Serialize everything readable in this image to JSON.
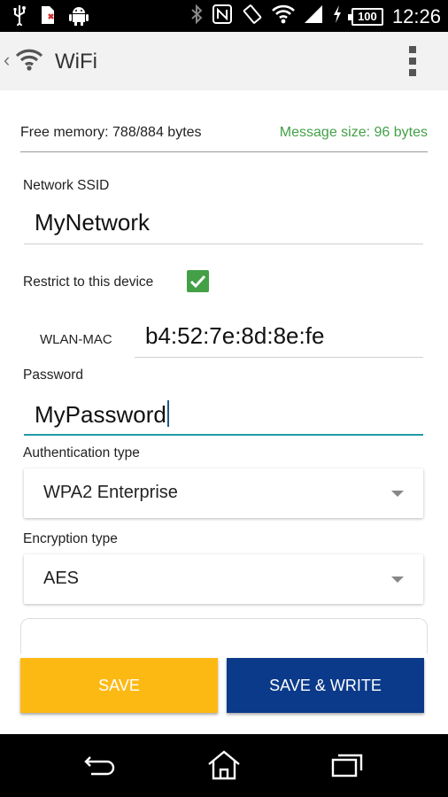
{
  "status_bar": {
    "battery": "100",
    "time": "12:26",
    "icons": [
      "usb-icon",
      "sim-error-icon",
      "android-icon",
      "bluetooth-icon",
      "nfc-icon",
      "rotate-icon",
      "wifi-signal-icon",
      "cell-signal-icon",
      "charging-icon",
      "battery-icon"
    ]
  },
  "action_bar": {
    "title": "WiFi",
    "icons": [
      "back-chevron-icon",
      "wifi-logo-icon",
      "overflow-menu-icon"
    ]
  },
  "memory": {
    "free": "Free memory: 788/884 bytes",
    "message_size": "Message size: 96 bytes",
    "message_color": "#43a047"
  },
  "form": {
    "ssid_label": "Network SSID",
    "ssid_value": "MyNetwork",
    "restrict_label": "Restrict to this device",
    "restrict_checked": true,
    "mac_label": "WLAN-MAC",
    "mac_value": "b4:52:7e:8d:8e:fe",
    "password_label": "Password",
    "password_value": "MyPassword",
    "auth_label": "Authentication type",
    "auth_value": "WPA2 Enterprise",
    "enc_label": "Encryption type",
    "enc_value": "AES"
  },
  "buttons": {
    "save": "SAVE",
    "save_write": "SAVE & WRITE",
    "save_color": "#fdb913",
    "save_write_color": "#0b3a8a"
  },
  "nav_bar": {
    "icons": [
      "back-icon",
      "home-icon",
      "recents-icon"
    ]
  }
}
